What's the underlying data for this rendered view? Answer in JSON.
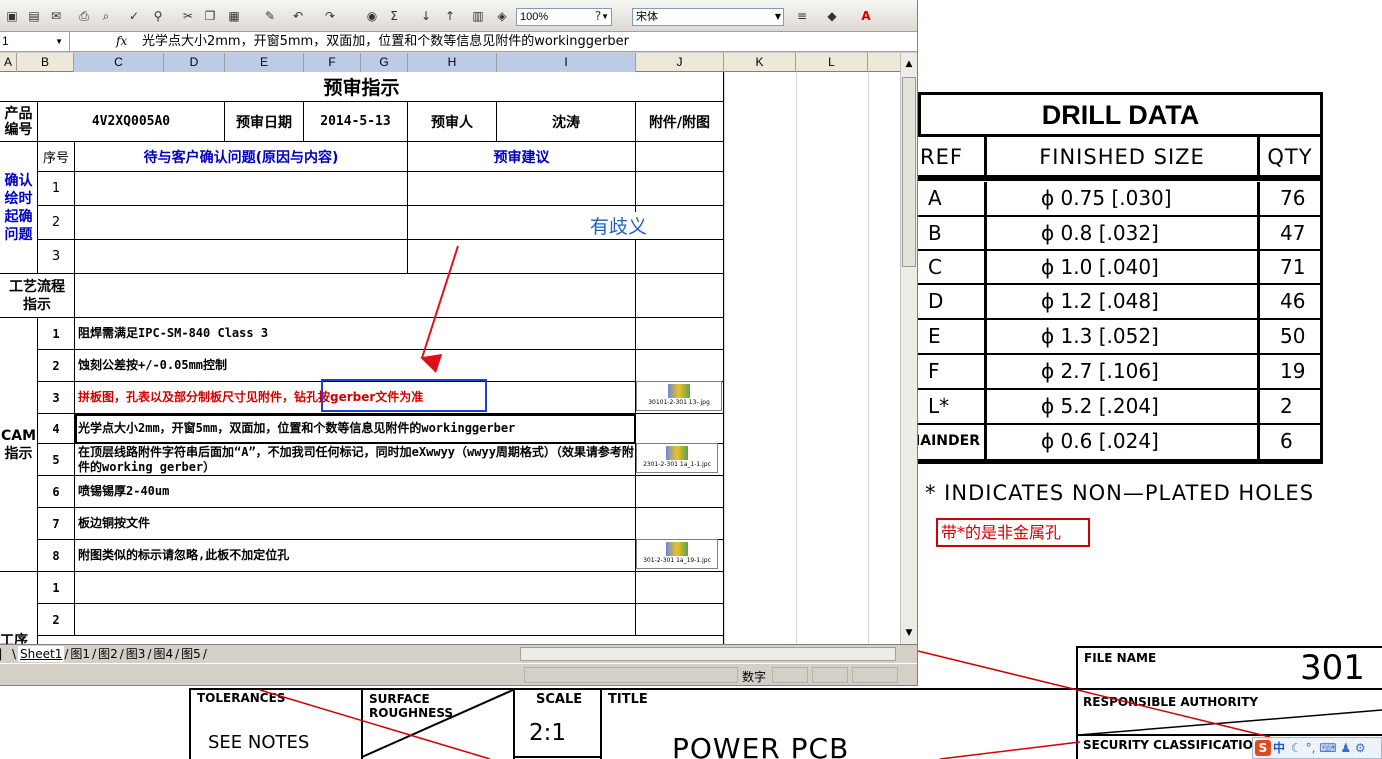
{
  "excel": {
    "name_box": "1",
    "fx_label": "fx",
    "formula": "光学点大小2mm，开窗5mm，双面加，位置和个数等信息见附件的workinggerber",
    "zoom": "100%",
    "font_name": "宋体",
    "columns": [
      "A",
      "B",
      "C",
      "D",
      "E",
      "F",
      "G",
      "H",
      "I",
      "J",
      "K",
      "L"
    ],
    "title": "预审指示",
    "header": {
      "product_label": "产品\n编号",
      "product_no": "4V2XQ005A0",
      "date_label": "预审日期",
      "date": "2014-5-13",
      "reviewer_label": "预审人",
      "reviewer": "沈涛",
      "attach_label": "附件/附图"
    },
    "confirm": {
      "seq_label": "序号",
      "issue_label": "待与客户确认问题(原因与内容)",
      "advice_label": "预审建议",
      "section_label": "确认\n绘时\n起确\n问题",
      "rows": [
        "1",
        "2",
        "3"
      ]
    },
    "process_label": "工艺流程\n指示",
    "cam": {
      "section_label": "CAM\n指示",
      "rows": [
        {
          "no": "1",
          "text": "阻焊需满足IPC-SM-840 Class 3"
        },
        {
          "no": "2",
          "text": "蚀刻公差按+/-0.05mm控制"
        },
        {
          "no": "3",
          "text": "拼板图，孔表以及部分制板尺寸见附件，钻孔按gerber文件为准"
        },
        {
          "no": "4",
          "text": "光学点大小2mm，开窗5mm，双面加，位置和个数等信息见附件的workinggerber"
        },
        {
          "no": "5",
          "text": "在顶层线路附件字符串后面加“A”，不加我司任何标记，同时加eXwwyy（wwyy周期格式）（效果请参考附件的working gerber）"
        },
        {
          "no": "6",
          "text": "喷锡锡厚2-40um"
        },
        {
          "no": "7",
          "text": "板边铜按文件"
        },
        {
          "no": "8",
          "text": "附图类似的标示请忽略,此板不加定位孔"
        }
      ]
    },
    "extra_rows": [
      "1",
      "2"
    ],
    "bottom_label": "工序",
    "thumbs": [
      "30101-2-301 13-.jpg",
      "2301-2-301 1a_1-1.jpc",
      "301-2-301 1a_19-1.jpc"
    ],
    "sheet_tabs": [
      "Sheet1",
      "图1",
      "图2",
      "图3",
      "图4",
      "图5"
    ],
    "status": "数字"
  },
  "annotations": {
    "ambiguous": "有歧义",
    "non_metal_note": "带*的是非金属孔"
  },
  "drill": {
    "title": "DRILL  DATA",
    "headers": [
      "REF",
      "FINISHED  SIZE",
      "QTY"
    ],
    "rows": [
      {
        "ref": "A",
        "size": "ϕ 0.75 [.030]",
        "qty": "76"
      },
      {
        "ref": "B",
        "size": "ϕ 0.8 [.032]",
        "qty": "47"
      },
      {
        "ref": "C",
        "size": "ϕ 1.0 [.040]",
        "qty": "71"
      },
      {
        "ref": "D",
        "size": "ϕ 1.2 [.048]",
        "qty": "46"
      },
      {
        "ref": "E",
        "size": "ϕ 1.3 [.052]",
        "qty": "50"
      },
      {
        "ref": "F",
        "size": "ϕ 2.7 [.106]",
        "qty": "19"
      },
      {
        "ref": "L*",
        "size": "ϕ 5.2 [.204]",
        "qty": "2"
      },
      {
        "ref": "REMAINDER",
        "size": "ϕ 0.6 [.024]",
        "qty": "6"
      }
    ],
    "footnote": "* INDICATES  NON—PLATED  HOLES"
  },
  "titleblock": {
    "tolerances": "TOLERANCES",
    "see_notes": "SEE  NOTES",
    "surface": "SURFACE\nROUGHNESS",
    "scale_label": "SCALE",
    "scale": "2:1",
    "title_label": "TITLE",
    "title": "POWER  PCB",
    "file_name_label": "FILE NAME",
    "file_name": "301",
    "responsible": "RESPONSIBLE  AUTHORITY",
    "security": "SECURITY  CLASSIFICATION"
  },
  "ime": {
    "logo": "S",
    "mode": "中"
  }
}
